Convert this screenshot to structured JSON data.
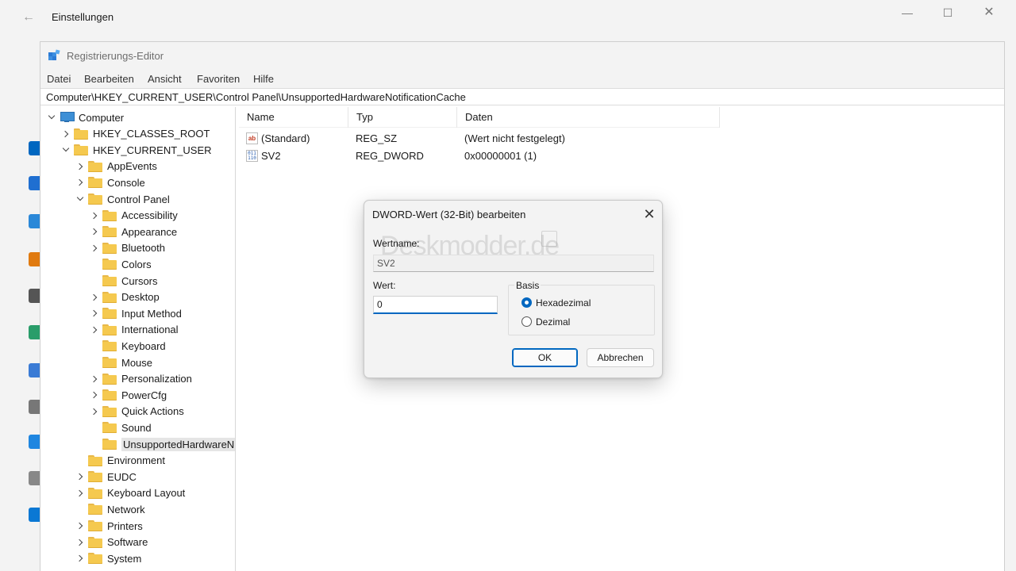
{
  "settings": {
    "title": "Einstellungen",
    "back_icon": "back-arrow-icon",
    "window_controls": {
      "minimize": "—",
      "maximize": "☐",
      "close": "✕"
    },
    "sidebar_icon_colors": [
      "#0067c0",
      "#1f6fd1",
      "#2b88d8",
      "#e07a10",
      "#555555",
      "#2a9d6a",
      "#3a7bd5",
      "#777777",
      "#1f86e0",
      "#888888",
      "#0a78d4"
    ]
  },
  "regedit": {
    "title": "Registrierungs-Editor",
    "menu": [
      "Datei",
      "Bearbeiten",
      "Ansicht",
      "Favoriten",
      "Hilfe"
    ],
    "address": "Computer\\HKEY_CURRENT_USER\\Control Panel\\UnsupportedHardwareNotificationCache",
    "tree": [
      {
        "label": "Computer",
        "level": 0,
        "chevron": "down",
        "icon": "computer-icon"
      },
      {
        "label": "HKEY_CLASSES_ROOT",
        "level": 1,
        "chevron": "right",
        "icon": "folder-icon"
      },
      {
        "label": "HKEY_CURRENT_USER",
        "level": 1,
        "chevron": "down",
        "icon": "folder-icon"
      },
      {
        "label": "AppEvents",
        "level": 2,
        "chevron": "right",
        "icon": "folder-icon"
      },
      {
        "label": "Console",
        "level": 2,
        "chevron": "right",
        "icon": "folder-icon"
      },
      {
        "label": "Control Panel",
        "level": 2,
        "chevron": "down",
        "icon": "folder-icon"
      },
      {
        "label": "Accessibility",
        "level": 3,
        "chevron": "right",
        "icon": "folder-icon"
      },
      {
        "label": "Appearance",
        "level": 3,
        "chevron": "right",
        "icon": "folder-icon"
      },
      {
        "label": "Bluetooth",
        "level": 3,
        "chevron": "right",
        "icon": "folder-icon"
      },
      {
        "label": "Colors",
        "level": 3,
        "chevron": "none",
        "icon": "folder-icon"
      },
      {
        "label": "Cursors",
        "level": 3,
        "chevron": "none",
        "icon": "folder-icon"
      },
      {
        "label": "Desktop",
        "level": 3,
        "chevron": "right",
        "icon": "folder-icon"
      },
      {
        "label": "Input Method",
        "level": 3,
        "chevron": "right",
        "icon": "folder-icon"
      },
      {
        "label": "International",
        "level": 3,
        "chevron": "right",
        "icon": "folder-icon"
      },
      {
        "label": "Keyboard",
        "level": 3,
        "chevron": "none",
        "icon": "folder-icon"
      },
      {
        "label": "Mouse",
        "level": 3,
        "chevron": "none",
        "icon": "folder-icon"
      },
      {
        "label": "Personalization",
        "level": 3,
        "chevron": "right",
        "icon": "folder-icon"
      },
      {
        "label": "PowerCfg",
        "level": 3,
        "chevron": "right",
        "icon": "folder-icon"
      },
      {
        "label": "Quick Actions",
        "level": 3,
        "chevron": "right",
        "icon": "folder-icon"
      },
      {
        "label": "Sound",
        "level": 3,
        "chevron": "none",
        "icon": "folder-icon"
      },
      {
        "label": "UnsupportedHardwareN",
        "level": 3,
        "chevron": "none",
        "icon": "folder-icon",
        "selected": true
      },
      {
        "label": "Environment",
        "level": 2,
        "chevron": "none",
        "icon": "folder-icon"
      },
      {
        "label": "EUDC",
        "level": 2,
        "chevron": "right",
        "icon": "folder-icon"
      },
      {
        "label": "Keyboard Layout",
        "level": 2,
        "chevron": "right",
        "icon": "folder-icon"
      },
      {
        "label": "Network",
        "level": 2,
        "chevron": "none",
        "icon": "folder-icon"
      },
      {
        "label": "Printers",
        "level": 2,
        "chevron": "right",
        "icon": "folder-icon"
      },
      {
        "label": "Software",
        "level": 2,
        "chevron": "right",
        "icon": "folder-icon"
      },
      {
        "label": "System",
        "level": 2,
        "chevron": "right",
        "icon": "folder-icon"
      }
    ],
    "list": {
      "columns": [
        "Name",
        "Typ",
        "Daten"
      ],
      "rows": [
        {
          "name": "(Standard)",
          "type": "REG_SZ",
          "data": "(Wert nicht festgelegt)",
          "icon": "string-value-icon",
          "icon_text": "ab"
        },
        {
          "name": "SV2",
          "type": "REG_DWORD",
          "data": "0x00000001 (1)",
          "icon": "binary-value-icon",
          "icon_text": "011\n110"
        }
      ]
    }
  },
  "dialog": {
    "title": "DWORD-Wert (32-Bit) bearbeiten",
    "name_label": "Wertname:",
    "name_value": "SV2",
    "value_label": "Wert:",
    "value": "0",
    "basis_label": "Basis",
    "radio_hex": "Hexadezimal",
    "radio_dec": "Dezimal",
    "selected_basis": "Hexadezimal",
    "ok": "OK",
    "cancel": "Abbrechen",
    "watermark": "Deskmodder.de",
    "accent": "#0067c0"
  }
}
